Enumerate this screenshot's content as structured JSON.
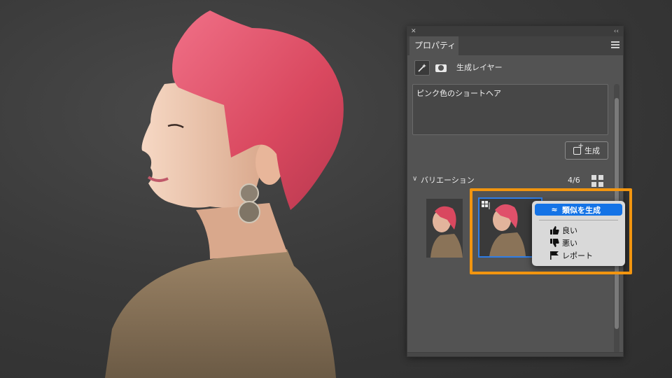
{
  "panel": {
    "close_glyph": "✕",
    "collapse_glyph": "‹‹",
    "tab_label": "プロパティ",
    "menu_icon": "hamburger-menu-icon",
    "layer_type_label": "生成レイヤー",
    "prompt_text": "ピンク色のショートヘア",
    "generate_button_label": "生成",
    "variations": {
      "section_title": "バリエーション",
      "count": "4/6",
      "collapse_glyph": "∨",
      "selected_index": 2
    }
  },
  "context_menu": {
    "similar_label": "類似を生成",
    "similar_icon": "approx-equal-icon",
    "good_label": "良い",
    "good_icon": "thumbs-up-icon",
    "bad_label": "悪い",
    "bad_icon": "thumbs-down-icon",
    "report_label": "レポート",
    "report_icon": "flag-icon"
  },
  "colors": {
    "highlight": "#1473e6",
    "selection_border": "#2f7de6",
    "callout_frame": "#f2950f",
    "hair": "#e0506a",
    "panel_bg": "#535353"
  }
}
